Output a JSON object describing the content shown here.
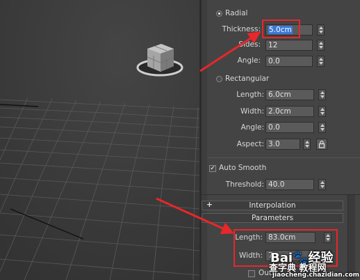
{
  "radial": {
    "label": "Radial",
    "thickness_label": "Thickness:",
    "thickness_value": "5.0cm",
    "sides_label": "Sides:",
    "sides_value": "12",
    "angle_label": "Angle:",
    "angle_value": "0.0"
  },
  "rectangular": {
    "label": "Rectangular",
    "length_label": "Length:",
    "length_value": "6.0cm",
    "width_label": "Width:",
    "width_value": "2.0cm",
    "angle_label": "Angle:",
    "angle_value": "0.0",
    "aspect_label": "Aspect:",
    "aspect_value": "3.0"
  },
  "auto_smooth": {
    "label": "Auto Smooth",
    "threshold_label": "Threshold:",
    "threshold_value": "40.0"
  },
  "rollouts": {
    "interpolation_label": "Interpolation",
    "interpolation_toggle": "+",
    "parameters_label": "Parameters"
  },
  "parameters": {
    "length_label": "Length:",
    "length_value": "83.0cm",
    "width_label": "Width:",
    "width_value": "7",
    "partial_label": "Outl"
  },
  "watermark": {
    "brand": "Bai",
    "brand_suffix": "经验",
    "line2": "查字典 教程网",
    "url": "jiaocheng.chazidian.com"
  },
  "colors": {
    "highlight": "#e8272a",
    "selection": "#3b78d8",
    "panel_bg": "#444444",
    "viewport_bg": "#3b3b3b"
  }
}
